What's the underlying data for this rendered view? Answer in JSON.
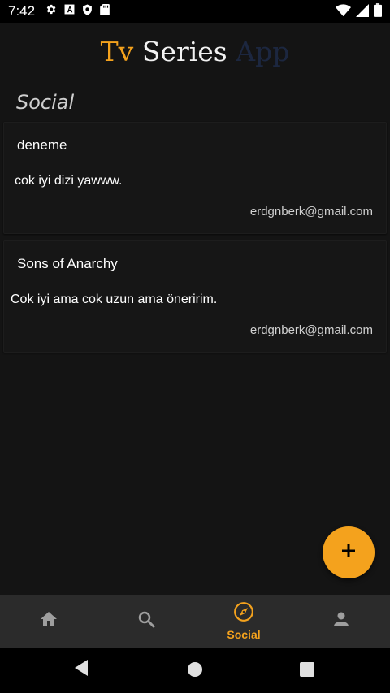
{
  "status_bar": {
    "time": "7:42"
  },
  "app_title": {
    "part1": "Tv",
    "part2": "Series",
    "part3": "App"
  },
  "section_title": "Social",
  "posts": [
    {
      "title": "deneme",
      "body": "cok iyi dizi yawww.",
      "email": "erdgnberk@gmail.com"
    },
    {
      "title": "Sons of Anarchy",
      "body": "Cok iyi ama cok uzun ama öneririm.",
      "email": "erdgnberk@gmail.com"
    }
  ],
  "bottom_nav": {
    "items": [
      {
        "icon": "home-icon",
        "label": ""
      },
      {
        "icon": "search-icon",
        "label": ""
      },
      {
        "icon": "compass-icon",
        "label": "Social",
        "active": true
      },
      {
        "icon": "person-icon",
        "label": ""
      }
    ]
  },
  "colors": {
    "accent": "#f4a21d",
    "background": "#141414",
    "nav_bar": "#2b2b2b",
    "inactive_icon": "#9e9e9e"
  }
}
